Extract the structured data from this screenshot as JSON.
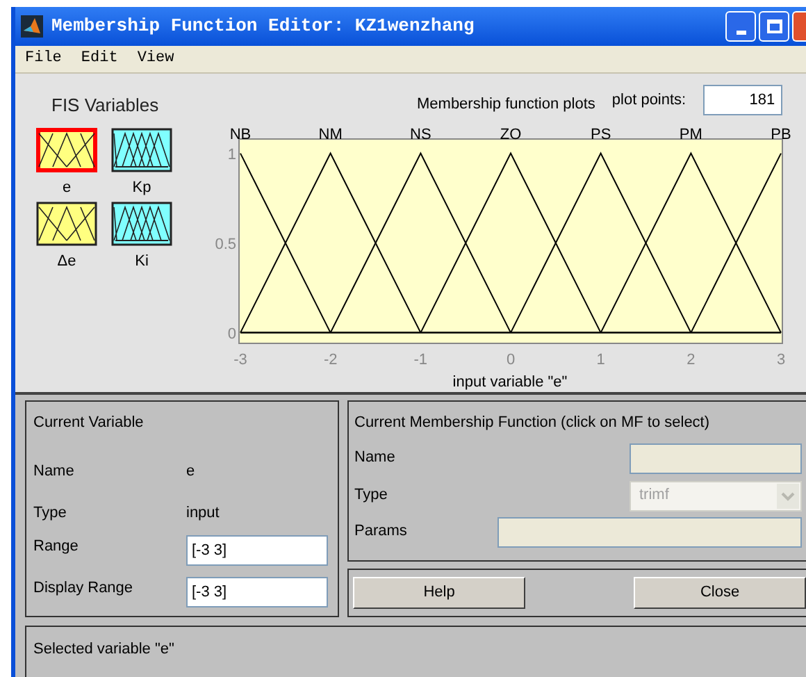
{
  "window": {
    "title": "Membership Function Editor: KZ1wenzhang"
  },
  "menu": [
    "File",
    "Edit",
    "View"
  ],
  "fis_variables": {
    "title": "FIS Variables",
    "items": [
      {
        "label": "e",
        "kind": "input",
        "selected": true
      },
      {
        "label": "Kp",
        "kind": "output",
        "selected": false
      },
      {
        "label": "Δe",
        "kind": "input",
        "selected": false
      },
      {
        "label": "Ki",
        "kind": "output",
        "selected": false
      }
    ]
  },
  "plot": {
    "title": "Membership function plots",
    "plot_points_label": "plot points:",
    "plot_points": "181",
    "chart_data": {
      "type": "line",
      "xlabel": "input variable \"e\"",
      "x": [
        -3,
        -2,
        -1,
        0,
        1,
        2,
        3
      ],
      "xlim": [
        -3,
        3
      ],
      "ylim": [
        -0.06,
        1.08
      ],
      "xticks": [
        -3,
        -2,
        -1,
        0,
        1,
        2,
        3
      ],
      "yticks": [
        0,
        {
          "value": 0.5,
          "label": "0.5"
        },
        1
      ],
      "series": [
        {
          "name": "NB",
          "color": "#000000",
          "values": [
            1,
            0,
            null,
            null,
            null,
            null,
            null
          ]
        },
        {
          "name": "NM",
          "color": "#000000",
          "values": [
            0,
            1,
            0,
            null,
            null,
            null,
            null
          ]
        },
        {
          "name": "NS",
          "color": "#000000",
          "values": [
            null,
            0,
            1,
            0,
            null,
            null,
            null
          ]
        },
        {
          "name": "ZO",
          "color": "#000000",
          "values": [
            null,
            null,
            0,
            1,
            0,
            null,
            null
          ]
        },
        {
          "name": "PS",
          "color": "#000000",
          "values": [
            null,
            null,
            null,
            0,
            1,
            0,
            null
          ]
        },
        {
          "name": "PM",
          "color": "#000000",
          "values": [
            null,
            null,
            null,
            null,
            0,
            1,
            0
          ]
        },
        {
          "name": "PB",
          "color": "#000000",
          "values": [
            null,
            null,
            null,
            null,
            null,
            0,
            1
          ]
        }
      ]
    }
  },
  "current_variable": {
    "title": "Current Variable",
    "name_label": "Name",
    "name": "e",
    "type_label": "Type",
    "type": "input",
    "range_label": "Range",
    "range": "[-3 3]",
    "display_range_label": "Display Range",
    "display_range": "[-3 3]"
  },
  "current_mf": {
    "title": "Current Membership Function (click on MF to select)",
    "name_label": "Name",
    "type_label": "Type",
    "type": "trimf",
    "type_disabled": true,
    "params_label": "Params"
  },
  "buttons": [
    "Help",
    "Close"
  ],
  "status": "Selected variable \"e\""
}
